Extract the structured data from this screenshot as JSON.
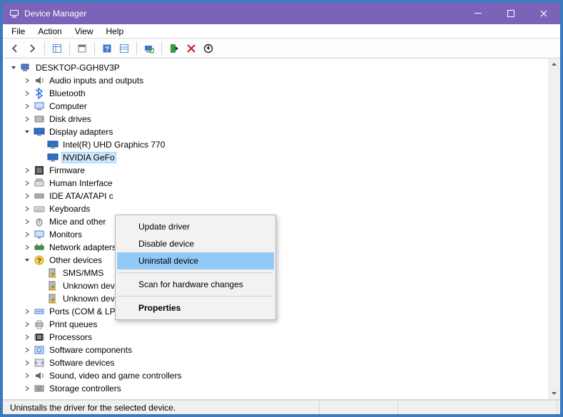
{
  "window": {
    "title": "Device Manager"
  },
  "menu": {
    "items": [
      "File",
      "Action",
      "View",
      "Help"
    ]
  },
  "context_menu": {
    "items": [
      {
        "label": "Update driver",
        "highlight": false
      },
      {
        "label": "Disable device",
        "highlight": false
      },
      {
        "label": "Uninstall device",
        "highlight": true
      },
      {
        "sep": true
      },
      {
        "label": "Scan for hardware changes",
        "highlight": false
      },
      {
        "sep": true
      },
      {
        "label": "Properties",
        "bold": true
      }
    ]
  },
  "status": {
    "text": "Uninstalls the driver for the selected device."
  },
  "tree": [
    {
      "indent": 0,
      "twisty": "open",
      "icon": "computer-root",
      "label": "DESKTOP-GGH8V3P"
    },
    {
      "indent": 1,
      "twisty": "closed",
      "icon": "audio",
      "label": "Audio inputs and outputs"
    },
    {
      "indent": 1,
      "twisty": "closed",
      "icon": "bluetooth",
      "label": "Bluetooth"
    },
    {
      "indent": 1,
      "twisty": "closed",
      "icon": "computer",
      "label": "Computer"
    },
    {
      "indent": 1,
      "twisty": "closed",
      "icon": "disk",
      "label": "Disk drives"
    },
    {
      "indent": 1,
      "twisty": "open",
      "icon": "display",
      "label": "Display adapters"
    },
    {
      "indent": 2,
      "twisty": "none",
      "icon": "display",
      "label": "Intel(R) UHD Graphics 770"
    },
    {
      "indent": 2,
      "twisty": "none",
      "icon": "display",
      "label": "NVIDIA GeFo",
      "selected": true
    },
    {
      "indent": 1,
      "twisty": "closed",
      "icon": "firmware",
      "label": "Firmware"
    },
    {
      "indent": 1,
      "twisty": "closed",
      "icon": "hid",
      "label": "Human Interface"
    },
    {
      "indent": 1,
      "twisty": "closed",
      "icon": "ide",
      "label": "IDE ATA/ATAPI c"
    },
    {
      "indent": 1,
      "twisty": "closed",
      "icon": "keyboard",
      "label": "Keyboards"
    },
    {
      "indent": 1,
      "twisty": "closed",
      "icon": "mouse",
      "label": "Mice and other"
    },
    {
      "indent": 1,
      "twisty": "closed",
      "icon": "monitor",
      "label": "Monitors"
    },
    {
      "indent": 1,
      "twisty": "closed",
      "icon": "network",
      "label": "Network adapters"
    },
    {
      "indent": 1,
      "twisty": "open",
      "icon": "other",
      "label": "Other devices"
    },
    {
      "indent": 2,
      "twisty": "none",
      "icon": "warn",
      "label": "SMS/MMS"
    },
    {
      "indent": 2,
      "twisty": "none",
      "icon": "warn",
      "label": "Unknown device"
    },
    {
      "indent": 2,
      "twisty": "none",
      "icon": "warn",
      "label": "Unknown device"
    },
    {
      "indent": 1,
      "twisty": "closed",
      "icon": "ports",
      "label": "Ports (COM & LPT)"
    },
    {
      "indent": 1,
      "twisty": "closed",
      "icon": "printer",
      "label": "Print queues"
    },
    {
      "indent": 1,
      "twisty": "closed",
      "icon": "cpu",
      "label": "Processors"
    },
    {
      "indent": 1,
      "twisty": "closed",
      "icon": "softcomp",
      "label": "Software components"
    },
    {
      "indent": 1,
      "twisty": "closed",
      "icon": "softdev",
      "label": "Software devices"
    },
    {
      "indent": 1,
      "twisty": "closed",
      "icon": "audio",
      "label": "Sound, video and game controllers"
    },
    {
      "indent": 1,
      "twisty": "closed",
      "icon": "storage",
      "label": "Storage controllers"
    }
  ]
}
